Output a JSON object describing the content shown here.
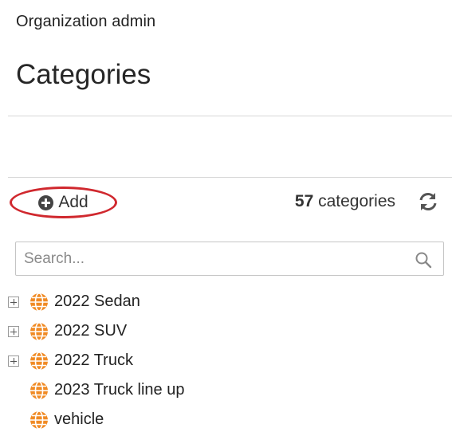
{
  "breadcrumb": "Organization admin",
  "page_title": "Categories",
  "toolbar": {
    "add_label": "Add",
    "count_number": "57",
    "count_label": "categories"
  },
  "search": {
    "placeholder": "Search...",
    "value": ""
  },
  "tree": {
    "items": [
      {
        "label": "2022 Sedan",
        "expandable": true
      },
      {
        "label": "2022 SUV",
        "expandable": true
      },
      {
        "label": "2022 Truck",
        "expandable": true
      },
      {
        "label": "2023 Truck line up",
        "expandable": false
      },
      {
        "label": "vehicle",
        "expandable": false
      }
    ]
  },
  "colors": {
    "highlight_ring": "#d0282e",
    "globe": "#f08a24"
  },
  "icons": {
    "add": "plus-circle-icon",
    "refresh": "refresh-icon",
    "search": "search-icon",
    "expander": "plus-square-icon",
    "category": "globe-icon"
  }
}
